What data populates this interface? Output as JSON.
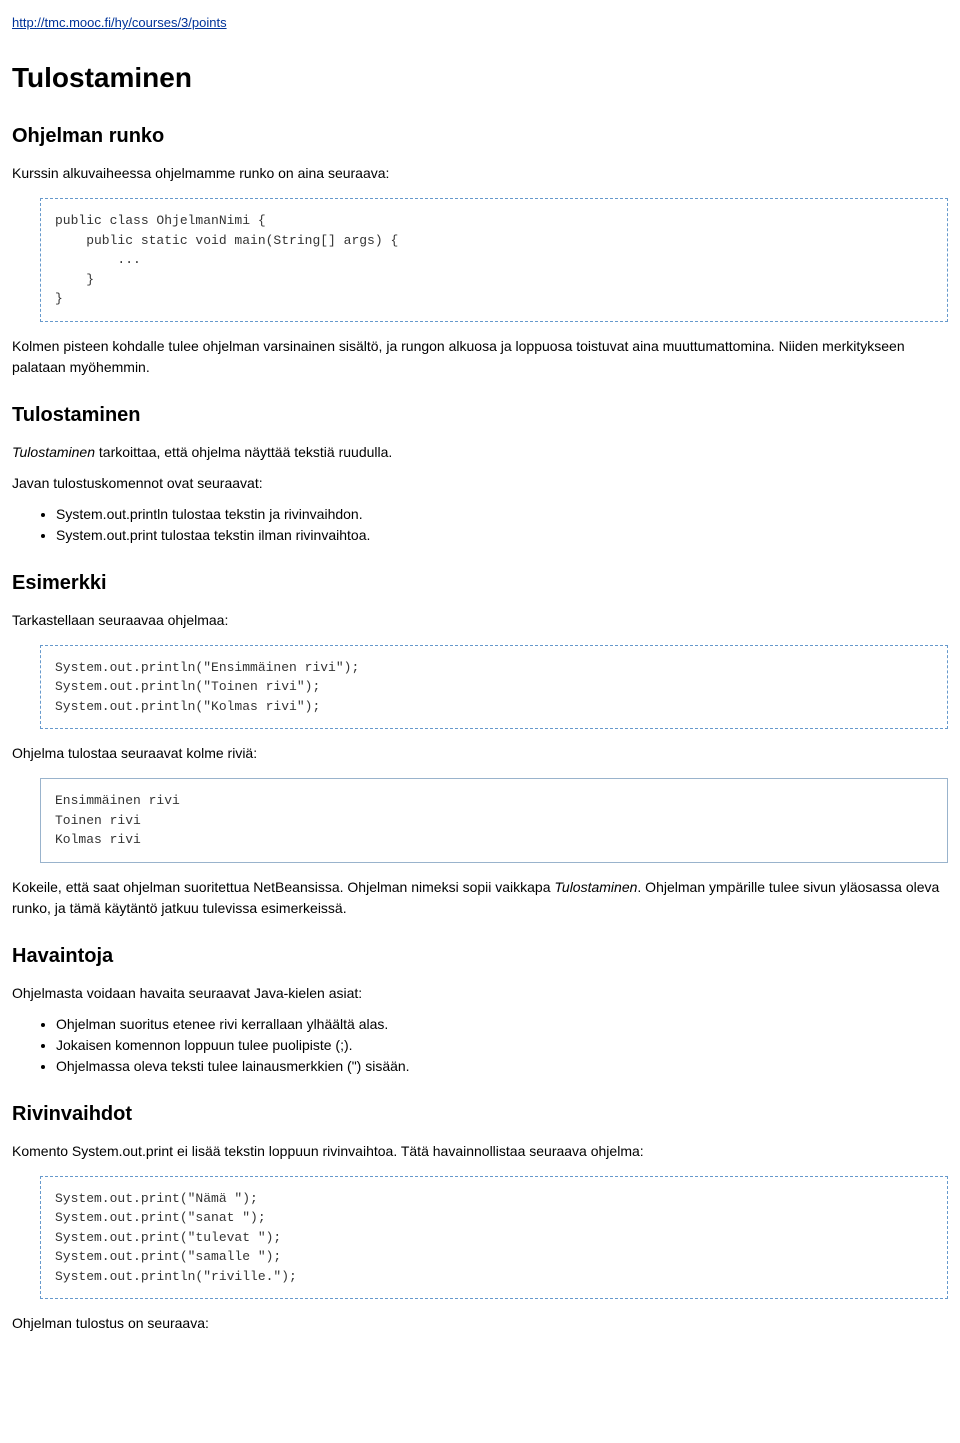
{
  "url": "http://tmc.mooc.fi/hy/courses/3/points",
  "h1": "Tulostaminen",
  "section1": {
    "heading": "Ohjelman runko",
    "p1": "Kurssin alkuvaiheessa ohjelmamme runko on aina seuraava:",
    "code1": "public class OhjelmanNimi {\n    public static void main(String[] args) {\n        ...\n    }\n}",
    "p2": "Kolmen pisteen kohdalle tulee ohjelman varsinainen sisältö, ja rungon alkuosa ja loppuosa toistuvat aina muuttumattomina. Niiden merkitykseen palataan myöhemmin."
  },
  "section2": {
    "heading": "Tulostaminen",
    "p1_italic": "Tulostaminen",
    "p1_rest": " tarkoittaa, että ohjelma näyttää tekstiä ruudulla.",
    "p2": "Javan tulostuskomennot ovat seuraavat:",
    "li1": "System.out.println tulostaa tekstin ja rivinvaihdon.",
    "li2": "System.out.print tulostaa tekstin ilman rivinvaihtoa."
  },
  "section3": {
    "heading": "Esimerkki",
    "p1": "Tarkastellaan seuraavaa ohjelmaa:",
    "code1": "System.out.println(\"Ensimmäinen rivi\");\nSystem.out.println(\"Toinen rivi\");\nSystem.out.println(\"Kolmas rivi\");",
    "p2": "Ohjelma tulostaa seuraavat kolme riviä:",
    "code2": "Ensimmäinen rivi\nToinen rivi\nKolmas rivi",
    "p3_a": "Kokeile, että saat ohjelman suoritettua NetBeansissa. Ohjelman nimeksi sopii vaikkapa ",
    "p3_italic": "Tulostaminen",
    "p3_b": ". Ohjelman ympärille tulee sivun yläosassa oleva runko, ja tämä käytäntö jatkuu tulevissa esimerkeissä."
  },
  "section4": {
    "heading": "Havaintoja",
    "p1": "Ohjelmasta voidaan havaita seuraavat Java-kielen asiat:",
    "li1": "Ohjelman suoritus etenee rivi kerrallaan ylhäältä alas.",
    "li2": "Jokaisen komennon loppuun tulee puolipiste (;).",
    "li3": "Ohjelmassa oleva teksti tulee lainausmerkkien (\") sisään."
  },
  "section5": {
    "heading": "Rivinvaihdot",
    "p1": "Komento System.out.print ei lisää tekstin loppuun rivinvaihtoa. Tätä havainnollistaa seuraava ohjelma:",
    "code1": "System.out.print(\"Nämä \");\nSystem.out.print(\"sanat \");\nSystem.out.print(\"tulevat \");\nSystem.out.print(\"samalle \");\nSystem.out.println(\"riville.\");",
    "p2": "Ohjelman tulostus on seuraava:"
  }
}
